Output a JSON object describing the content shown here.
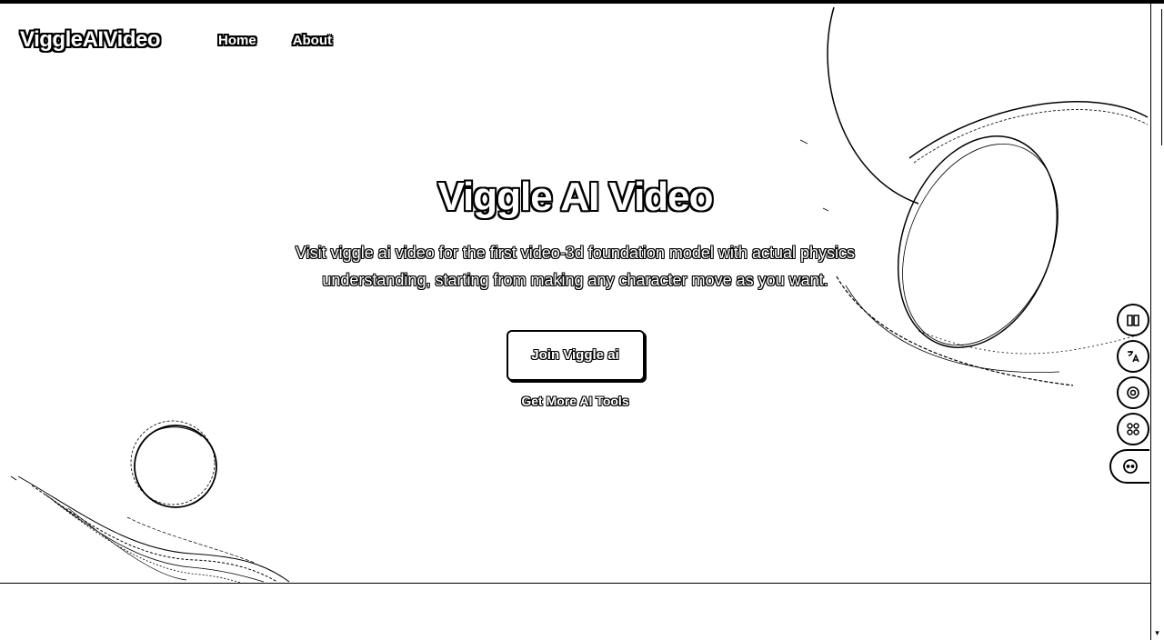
{
  "nav": {
    "logo": "ViggleAIVideo",
    "links": [
      {
        "label": "Home"
      },
      {
        "label": "About"
      }
    ]
  },
  "hero": {
    "title": "Viggle AI Video",
    "subtitle": "Visit viggle ai video for the first video-3d foundation model with actual physics understanding, starting from making any character move as you want.",
    "cta_label": "Join Viggle ai",
    "secondary_link": "Get More AI Tools"
  },
  "floating_tools": [
    {
      "icon": "book-icon"
    },
    {
      "icon": "translate-icon"
    },
    {
      "icon": "target-icon"
    },
    {
      "icon": "apps-grid-icon"
    },
    {
      "icon": "assistant-bot-icon"
    }
  ]
}
